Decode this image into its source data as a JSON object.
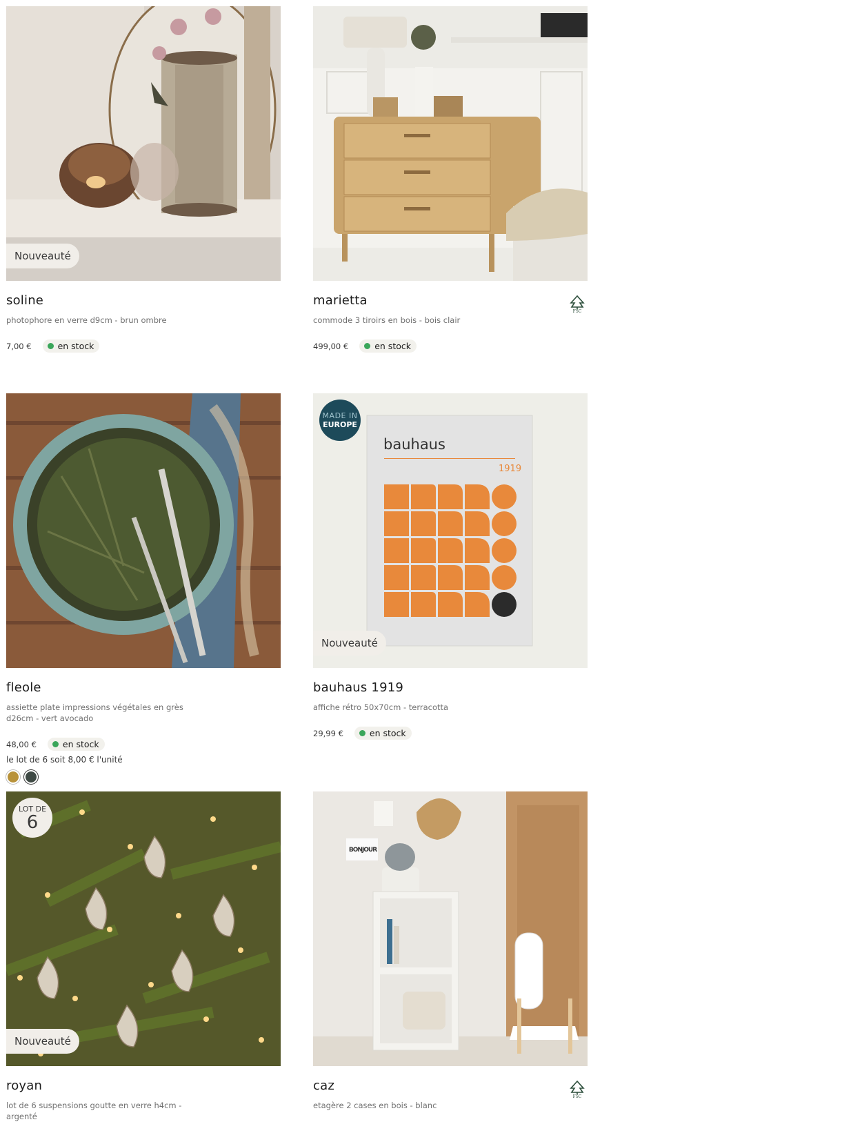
{
  "products": [
    {
      "name": "soline",
      "description": "photophore en verre d9cm - brun ombre",
      "price": "7,00 €",
      "stock": "en stock",
      "badge": "Nouveauté"
    },
    {
      "name": "marietta",
      "description": "commode 3 tiroirs en bois - bois clair",
      "price": "499,00 €",
      "stock": "en stock",
      "label": "FSC"
    },
    {
      "name": "fleole",
      "description": "assiette plate impressions végétales en grès d26cm - vert avocado",
      "price": "48,00 €",
      "stock": "en stock",
      "unit_price": "le lot de 6 soit 8,00 € l'unité",
      "swatches": [
        "#b8923a",
        "#3f4a45"
      ]
    },
    {
      "name": "bauhaus 1919",
      "description": "affiche rétro 50x70cm - terracotta",
      "price": "29,99 €",
      "stock": "en stock",
      "badge": "Nouveauté",
      "origin_badge_line1": "MADE IN",
      "origin_badge_line2": "EUROPE",
      "poster_title": "bauhaus",
      "poster_year": "1919"
    },
    {
      "name": "royan",
      "description": "lot de 6 suspensions goutte en verre h4cm - argenté",
      "badge": "Nouveauté",
      "lot_badge_line1": "LOT DE",
      "lot_badge_line2": "6"
    },
    {
      "name": "caz",
      "description": "etagère 2 cases en bois - blanc",
      "label": "FSC",
      "wall_sign": "BONJOUR"
    }
  ],
  "colors": {
    "stock_dot": "#3aa65a",
    "badge_bg": "#f1eee9",
    "origin_badge_bg": "#1d4a5a",
    "poster_orange": "#e8893b"
  },
  "icons": {
    "fsc": "fsc-tree-icon",
    "stock": "stock-dot-icon"
  }
}
